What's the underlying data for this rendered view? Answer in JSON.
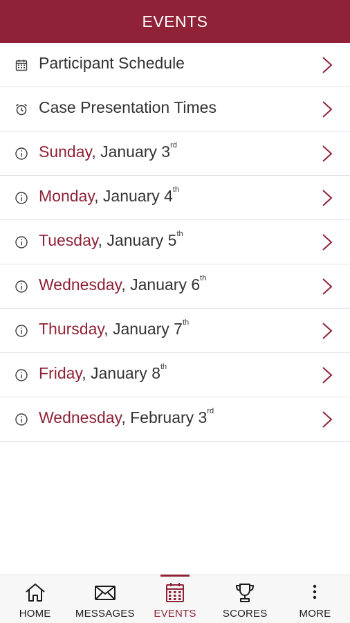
{
  "header": {
    "title": "EVENTS"
  },
  "colors": {
    "accent": "#8f2236",
    "text": "#333333",
    "divider": "#e1e3ec"
  },
  "rows": [
    {
      "icon": "calendar-icon",
      "label": "Participant Schedule"
    },
    {
      "icon": "alarm-clock-icon",
      "label": "Case Presentation Times"
    },
    {
      "icon": "info-icon",
      "day": "Sunday",
      "date": ", January 3",
      "suffix": "rd"
    },
    {
      "icon": "info-icon",
      "day": "Monday",
      "date": ", January 4",
      "suffix": "th"
    },
    {
      "icon": "info-icon",
      "day": "Tuesday",
      "date": ", January 5",
      "suffix": "th"
    },
    {
      "icon": "info-icon",
      "day": "Wednesday",
      "date": ", January 6",
      "suffix": "th"
    },
    {
      "icon": "info-icon",
      "day": "Thursday",
      "date": ", January 7",
      "suffix": "th"
    },
    {
      "icon": "info-icon",
      "day": "Friday",
      "date": ", January 8",
      "suffix": "th"
    },
    {
      "icon": "info-icon",
      "day": "Wednesday",
      "date": ", February 3",
      "suffix": "rd"
    }
  ],
  "tabs": [
    {
      "icon": "home-icon",
      "label": "HOME",
      "active": false
    },
    {
      "icon": "envelope-icon",
      "label": "MESSAGES",
      "active": false
    },
    {
      "icon": "calendar-icon",
      "label": "EVENTS",
      "active": true
    },
    {
      "icon": "trophy-icon",
      "label": "SCORES",
      "active": false
    },
    {
      "icon": "more-vertical-icon",
      "label": "MORE",
      "active": false
    }
  ]
}
